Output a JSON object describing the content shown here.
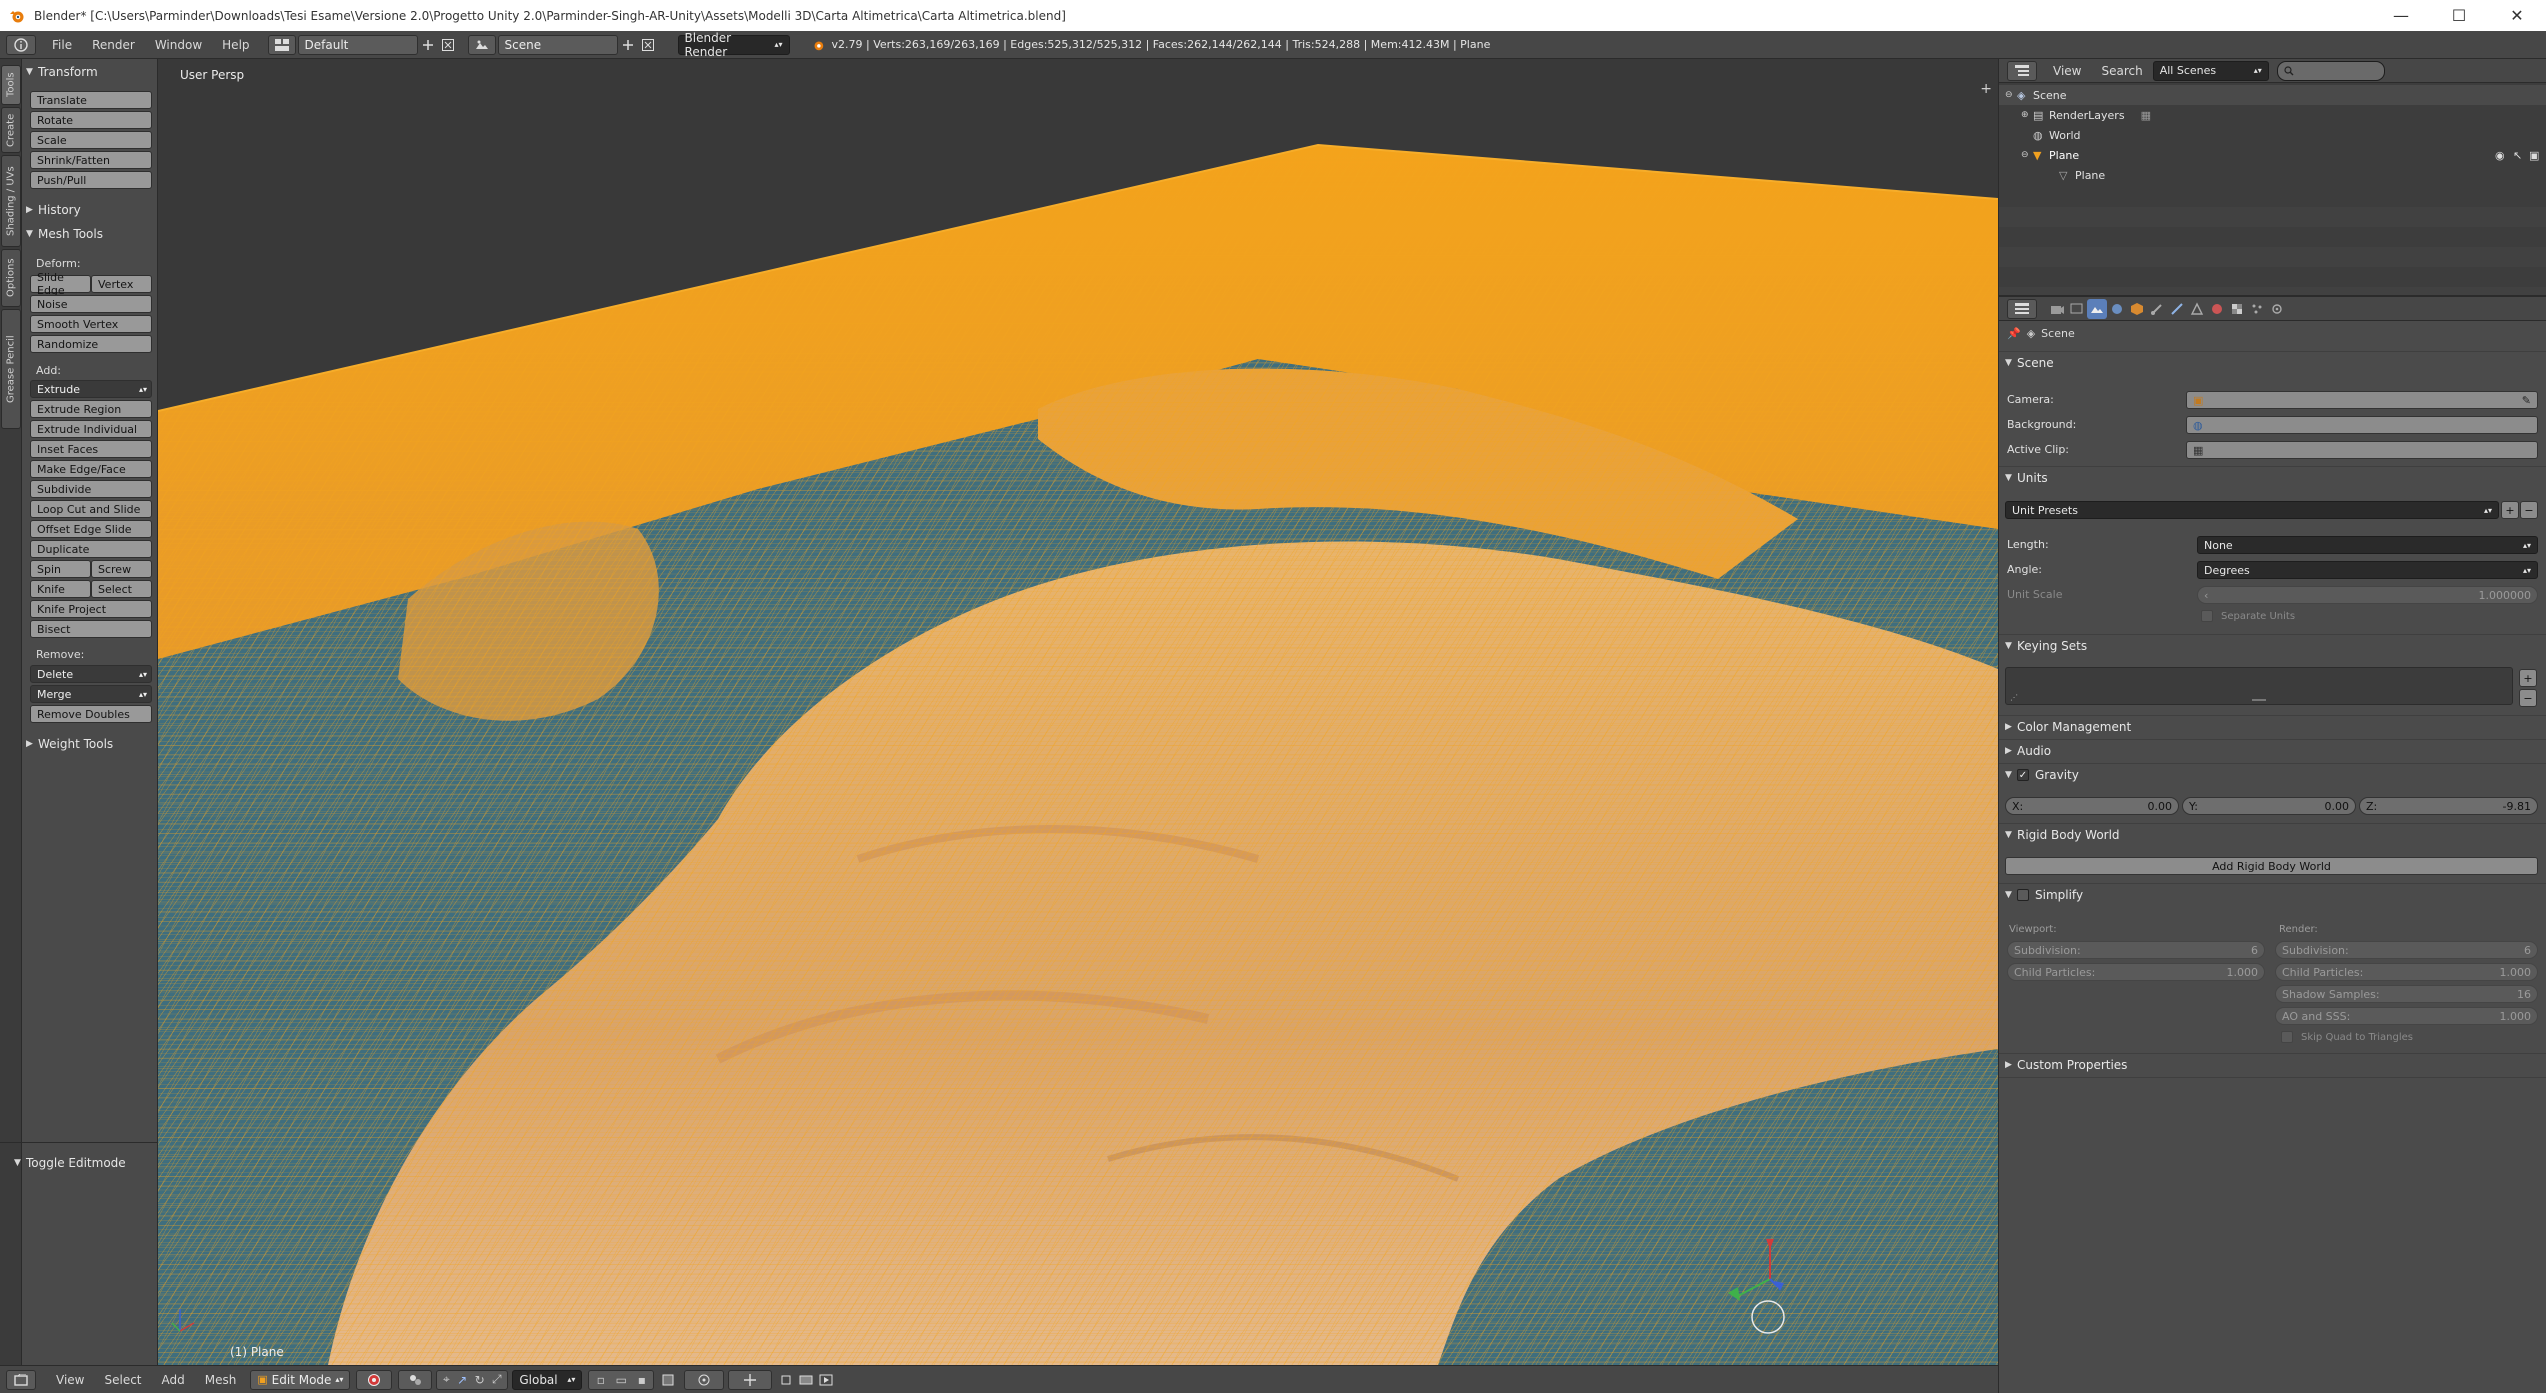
{
  "titlebar": {
    "title": "Blender* [C:\\Users\\Parminder\\Downloads\\Tesi Esame\\Versione 2.0\\Progetto Unity 2.0\\Parminder-Singh-AR-Unity\\Assets\\Modelli 3D\\Carta Altimetrica\\Carta Altimetrica.blend]",
    "minimize": "—",
    "maximize": "☐",
    "close": "✕"
  },
  "infobar": {
    "menus": [
      "File",
      "Render",
      "Window",
      "Help"
    ],
    "layout_value": "Default",
    "scene_value": "Scene",
    "render_engine": "Blender Render",
    "stats": "v2.79 | Verts:263,169/263,169 | Edges:525,312/525,312 | Faces:262,144/262,144 | Tris:524,288 | Mem:412.43M | Plane"
  },
  "shelf_tabs": [
    "Tools",
    "Create",
    "Shading / UVs",
    "Options",
    "Grease Pencil"
  ],
  "toolshelf": {
    "transform_header": "Transform",
    "transform_buttons": [
      "Translate",
      "Rotate",
      "Scale",
      "Shrink/Fatten",
      "Push/Pull"
    ],
    "history_header": "History",
    "mesh_tools_header": "Mesh Tools",
    "deform_label": "Deform:",
    "slide_edge": "Slide Edge",
    "vertex": "Vertex",
    "deform_buttons": [
      "Noise",
      "Smooth Vertex",
      "Randomize"
    ],
    "add_label": "Add:",
    "extrude": "Extrude",
    "add_buttons": [
      "Extrude Region",
      "Extrude Individual",
      "Inset Faces",
      "Make Edge/Face",
      "Subdivide",
      "Loop Cut and Slide",
      "Offset Edge Slide",
      "Duplicate"
    ],
    "spin": "Spin",
    "screw": "Screw",
    "knife": "Knife",
    "select": "Select",
    "knife_project": "Knife Project",
    "bisect": "Bisect",
    "remove_label": "Remove:",
    "delete": "Delete",
    "merge": "Merge",
    "remove_doubles": "Remove Doubles",
    "weight_tools_header": "Weight Tools",
    "toggle_editmode": "Toggle Editmode"
  },
  "viewport": {
    "view_label": "User Persp",
    "object_label": "(1) Plane"
  },
  "bottombar": {
    "menus": [
      "View",
      "Select",
      "Add",
      "Mesh"
    ],
    "mode": "Edit Mode",
    "orientation": "Global"
  },
  "outliner": {
    "menus": [
      "View",
      "Search"
    ],
    "filter": "All Scenes",
    "rows": [
      "Scene",
      "RenderLayers",
      "World",
      "Plane",
      "Plane"
    ]
  },
  "properties": {
    "breadcrumb": "Scene",
    "scene_header": "Scene",
    "camera_label": "Camera:",
    "background_label": "Background:",
    "active_clip_label": "Active Clip:",
    "units_header": "Units",
    "unit_presets": "Unit Presets",
    "length_label": "Length:",
    "length_value": "None",
    "angle_label": "Angle:",
    "angle_value": "Degrees",
    "unit_scale_label": "Unit Scale",
    "unit_scale_value": "1.000000",
    "separate_units": "Separate Units",
    "keying_sets_header": "Keying Sets",
    "color_management_header": "Color Management",
    "audio_header": "Audio",
    "gravity_header": "Gravity",
    "gravity": {
      "x_label": "X:",
      "x": "0.00",
      "y_label": "Y:",
      "y": "0.00",
      "z_label": "Z:",
      "z": "-9.81"
    },
    "rigid_body_header": "Rigid Body World",
    "add_rigid_body": "Add Rigid Body World",
    "simplify_header": "Simplify",
    "viewport_label": "Viewport:",
    "render_label": "Render:",
    "vp_subdivision_label": "Subdivision:",
    "vp_subdivision": "6",
    "vp_child_particles_label": "Child Particles:",
    "vp_child_particles": "1.000",
    "r_subdivision_label": "Subdivision:",
    "r_subdivision": "6",
    "r_child_particles_label": "Child Particles:",
    "r_child_particles": "1.000",
    "shadow_samples_label": "Shadow Samples:",
    "shadow_samples": "16",
    "ao_sss_label": "AO and SSS:",
    "ao_sss": "1.000",
    "skip_quad": "Skip Quad to Triangles",
    "custom_properties_header": "Custom Properties"
  },
  "colors": {
    "wire_orange": "#f0a020",
    "sea_teal": "#3f6e7e",
    "land_sand": "#d6a46a"
  }
}
